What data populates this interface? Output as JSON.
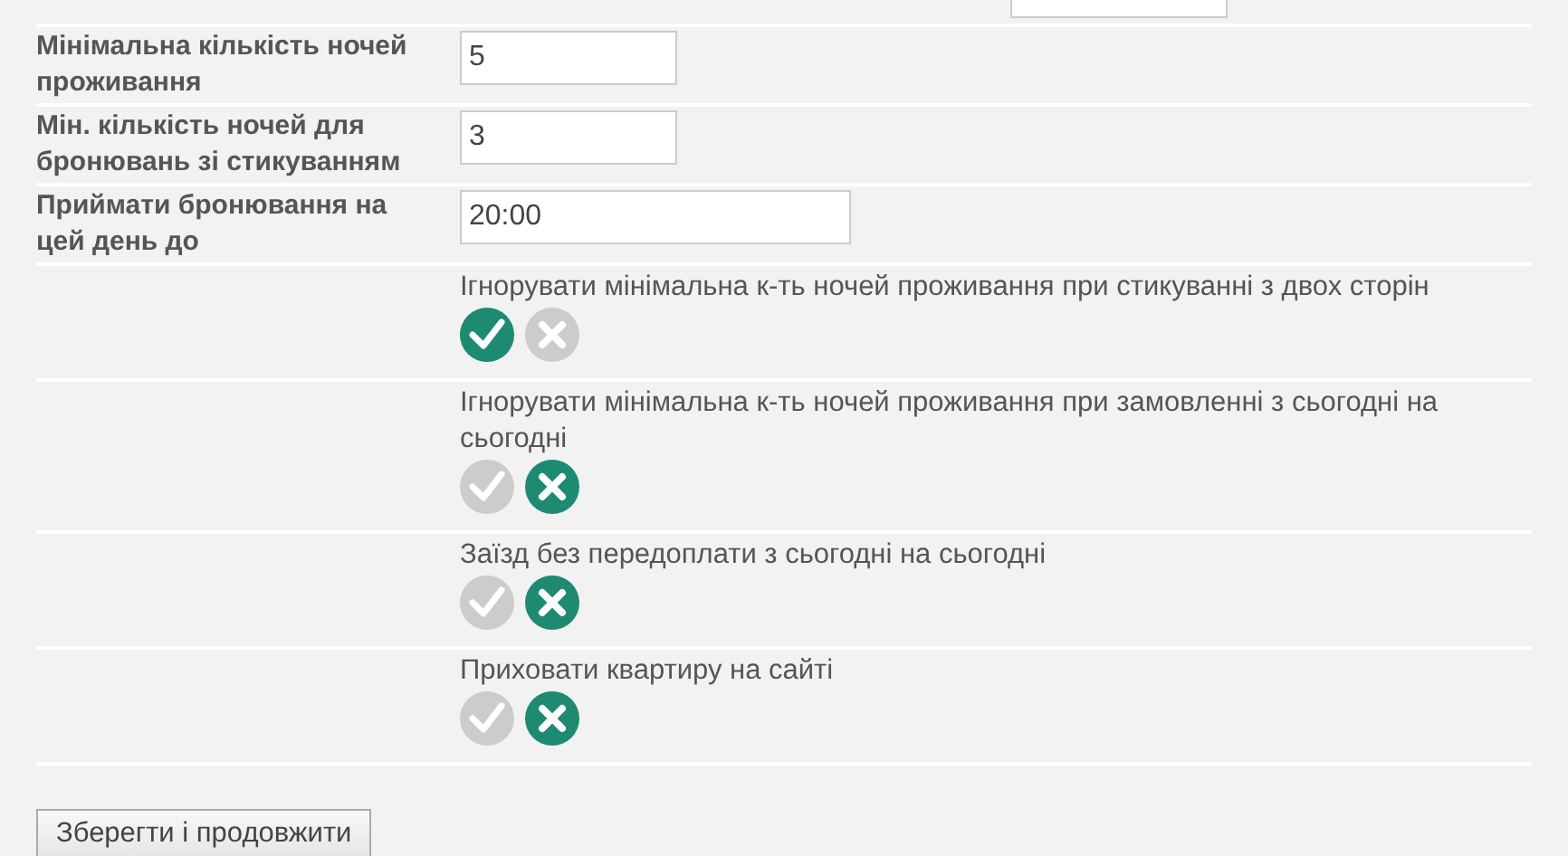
{
  "fields": [
    {
      "label": "Мінімальна кількість ночей проживання",
      "value": "5",
      "kind": "number"
    },
    {
      "label": "Мін. кількість ночей для бронювань зі стикуванням",
      "value": "3",
      "kind": "number"
    },
    {
      "label": "Приймати бронювання на цей день до",
      "value": "20:00",
      "kind": "time"
    }
  ],
  "options": [
    {
      "label": "Ігнорувати мінімальна к-ть ночей проживання при стикуванні з двох сторін",
      "on": true
    },
    {
      "label": "Ігнорувати мінімальна к-ть ночей проживання при замовленні з сьогодні на сьогодні",
      "on": false
    },
    {
      "label": "Заїзд без передоплати з сьогодні на сьогодні",
      "on": false
    },
    {
      "label": "Приховати квартиру на сайті",
      "on": false
    }
  ],
  "submit": "Зберегти і продовжити"
}
